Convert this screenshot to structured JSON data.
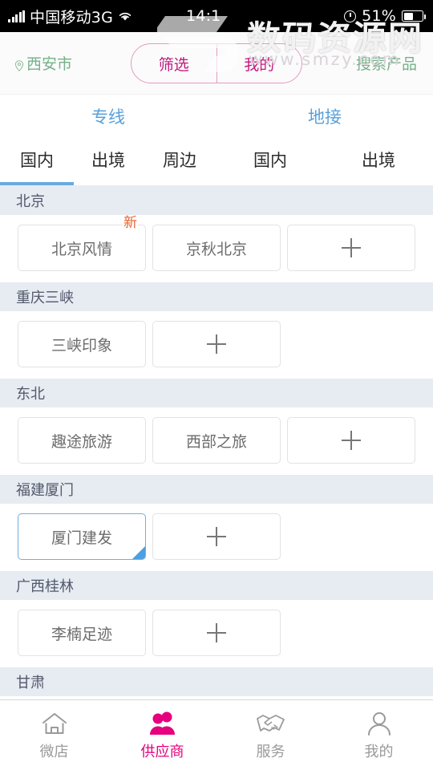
{
  "statusbar": {
    "carrier": "中国移动3G",
    "time": "14:1",
    "battery_percent": "51%",
    "icons": [
      "signal-icon",
      "wifi-icon",
      "alarm-clock-icon",
      "battery-icon"
    ]
  },
  "watermark": {
    "brand": "数码资源网",
    "url": "www.smzy.com"
  },
  "header": {
    "location": "西安市",
    "location_icon": "location-pin-icon",
    "search_label": "搜索产品",
    "segments": [
      {
        "label": "筛选"
      },
      {
        "label": "我的"
      }
    ],
    "accent": "#c2187d",
    "border": "#e39bc0"
  },
  "groups": [
    {
      "label": "专线",
      "center": 135
    },
    {
      "label": "地接",
      "center": 405
    }
  ],
  "tabs": [
    {
      "label": "国内",
      "center": 46,
      "active": true
    },
    {
      "label": "出境",
      "center": 135,
      "active": false
    },
    {
      "label": "周边",
      "center": 224,
      "active": false
    },
    {
      "label": "国内",
      "center": 337,
      "active": false
    },
    {
      "label": "出境",
      "center": 472,
      "active": false
    }
  ],
  "tab_underline": {
    "left": 0,
    "width": 92,
    "color": "#6aa9e0"
  },
  "sections": [
    {
      "title": "北京",
      "cards": [
        {
          "label": "北京风情",
          "badge": "新",
          "selected": false,
          "type": "item"
        },
        {
          "label": "京秋北京",
          "badge": "",
          "selected": false,
          "type": "item"
        },
        {
          "label": "",
          "badge": "",
          "selected": false,
          "type": "add"
        }
      ]
    },
    {
      "title": "重庆三峡",
      "cards": [
        {
          "label": "三峡印象",
          "badge": "",
          "selected": false,
          "type": "item"
        },
        {
          "label": "",
          "badge": "",
          "selected": false,
          "type": "add"
        }
      ]
    },
    {
      "title": "东北",
      "cards": [
        {
          "label": "趣途旅游",
          "badge": "",
          "selected": false,
          "type": "item"
        },
        {
          "label": "西部之旅",
          "badge": "",
          "selected": false,
          "type": "item"
        },
        {
          "label": "",
          "badge": "",
          "selected": false,
          "type": "add"
        }
      ]
    },
    {
      "title": "福建厦门",
      "cards": [
        {
          "label": "厦门建发",
          "badge": "",
          "selected": true,
          "type": "item"
        },
        {
          "label": "",
          "badge": "",
          "selected": false,
          "type": "add"
        }
      ]
    },
    {
      "title": "广西桂林",
      "cards": [
        {
          "label": "李楠足迹",
          "badge": "",
          "selected": false,
          "type": "item"
        },
        {
          "label": "",
          "badge": "",
          "selected": false,
          "type": "add"
        }
      ]
    },
    {
      "title": "甘肃",
      "cards": []
    }
  ],
  "bottomnav": {
    "active_color": "#e6007e",
    "items": [
      {
        "label": "微店",
        "icon": "home-icon",
        "active": false
      },
      {
        "label": "供应商",
        "icon": "suppliers-icon",
        "active": true
      },
      {
        "label": "服务",
        "icon": "handshake-icon",
        "active": false
      },
      {
        "label": "我的",
        "icon": "person-icon",
        "active": false
      }
    ]
  }
}
